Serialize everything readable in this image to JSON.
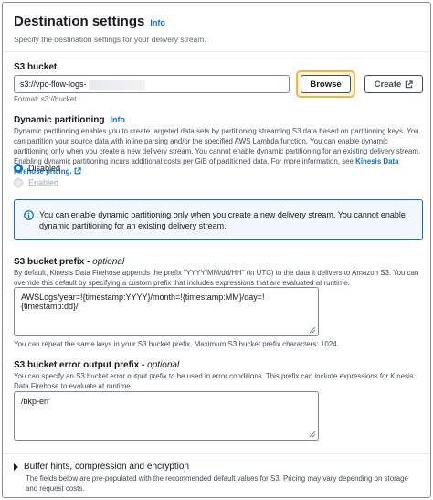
{
  "header": {
    "title": "Destination settings",
    "info": "Info",
    "subtitle": "Specify the destination settings for your delivery stream."
  },
  "s3_bucket": {
    "label": "S3 bucket",
    "value": "s3://vpc-flow-logs-",
    "format": "Format: s3://bucket",
    "browse_label": "Browse",
    "create_label": "Create"
  },
  "dynamic_partitioning": {
    "label": "Dynamic partitioning",
    "info": "Info",
    "description": "Dynamic partitioning enables you to create targeted data sets by partitioning streaming S3 data based on partitioning keys. You can partition your source data with inline parsing and/or the specified AWS Lambda function. You can enable dynamic partitioning only when you create a new delivery stream. You cannot enable dynamic partitioning for an existing delivery stream. Enabling dynamic partitioning incurs additional costs per GiB of partitioned data. For more information, see",
    "link": "Kinesis Data Firehose pricing.",
    "options": [
      "Disabled",
      "Enabled"
    ],
    "selected": "Disabled"
  },
  "info_alert": {
    "text": "You can enable dynamic partitioning only when you create a new delivery stream. You cannot enable dynamic partitioning for an existing delivery stream."
  },
  "prefix": {
    "label": "S3 bucket prefix",
    "optional": "optional",
    "description": "By default, Kinesis Data Firehose appends the prefix \"YYYY/MM/dd/HH\" (in UTC) to the data it delivers to Amazon S3. You can override this default by specifying a custom prefix that includes expressions that are evaluated at runtime.",
    "value": "AWSLogs/year=!{timestamp:YYYY}/month=!{timestamp:MM}/day=!{timestamp:dd}/",
    "note": "You can repeat the same keys in your S3 bucket prefix. Maximum S3 bucket prefix characters: 1024."
  },
  "error_prefix": {
    "label": "S3 bucket error output prefix",
    "optional": "optional",
    "description": "You can specify an S3 bucket error output prefix to be used in error conditions. This prefix can include expressions for Kinesis Data Firehose to evaluate at runtime.",
    "value": "/bkp-err"
  },
  "buffer": {
    "label": "Buffer hints, compression and encryption",
    "description": "The fields below are pre-populated with the recommended default values for S3. Pricing may vary depending on storage and request costs."
  },
  "colors": {
    "link": "#0972d3",
    "focus": "#e8b84a",
    "info_bg": "#f2f8fd"
  }
}
